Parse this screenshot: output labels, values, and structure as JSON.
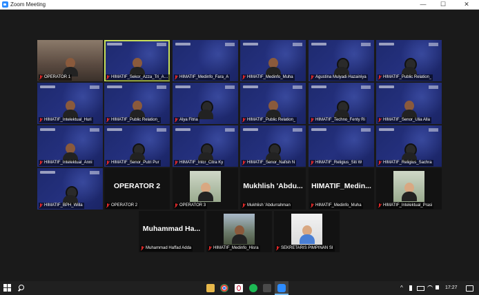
{
  "window": {
    "title": "Zoom Meeting",
    "controls": {
      "minimize": "—",
      "maximize": "☐",
      "close": "✕"
    }
  },
  "gallery": {
    "row1": [
      "OPERATOR 1",
      "HIMATIF_Sekor_Azza_Tri_Ana",
      "HIMATIF_Medinfo_Fara_A",
      "HIMATIF_Medinfo_Muha",
      "Agustina Mulyadi Hazainiya",
      "HIMATIF_Public Relation_"
    ],
    "row2": [
      "HIMATIF_Intelektual_Huri",
      "HIMATIF_Public Relation_",
      "Alya Fitria",
      "HIMATIF_Public Relation_",
      "HIMATIF_Techno_Fenty Ri",
      "HIMATIF_Senor_Ulia Alla"
    ],
    "row3": [
      "HIMATIF_Intelektual_Anni",
      "HIMATIF_Senor_Putri Pur",
      "HIMATIF_Intcr_Citra Ky",
      "HIMATIF_Senor_Nafish N",
      "HIMATIF_Religius_Siti W",
      "HIMATIF_Religius_Sachra"
    ],
    "row4": [
      {
        "name": "HIMATIF_BPH_Willa",
        "big": ""
      },
      {
        "name": "OPERATOR 2",
        "big": "OPERATOR 2"
      },
      {
        "name": "OPERATOR 3",
        "big": ""
      },
      {
        "name": "Mukhlish 'Abdurrahman",
        "big": "Mukhlish  'Abdu..."
      },
      {
        "name": "HIMATIF_Medinfo_Muha",
        "big": "HIMATIF_Medin..."
      },
      {
        "name": "HIMATIF_Intelektual_Prasi",
        "big": ""
      }
    ],
    "row5": [
      {
        "name": "Muhammad Haffad Adda",
        "big": "Muhammad  Ha..."
      },
      {
        "name": "HIMATIF_Medinfo_Hisra",
        "big": ""
      },
      {
        "name": "SEKRETARIS PIMPINAN SI",
        "big": ""
      }
    ]
  },
  "taskbar": {
    "apps": [
      "folder-icon",
      "chrome-icon",
      "opera-icon",
      "spotify-icon",
      "files-icon",
      "zoom-icon"
    ],
    "tray_chevron": "^",
    "clock": "17:27"
  },
  "colors": {
    "slide_bg": "#1e2a6e",
    "active_speaker": "#c8e05a",
    "muted_mic": "#e02828",
    "zoom_blue": "#2d8cff"
  }
}
